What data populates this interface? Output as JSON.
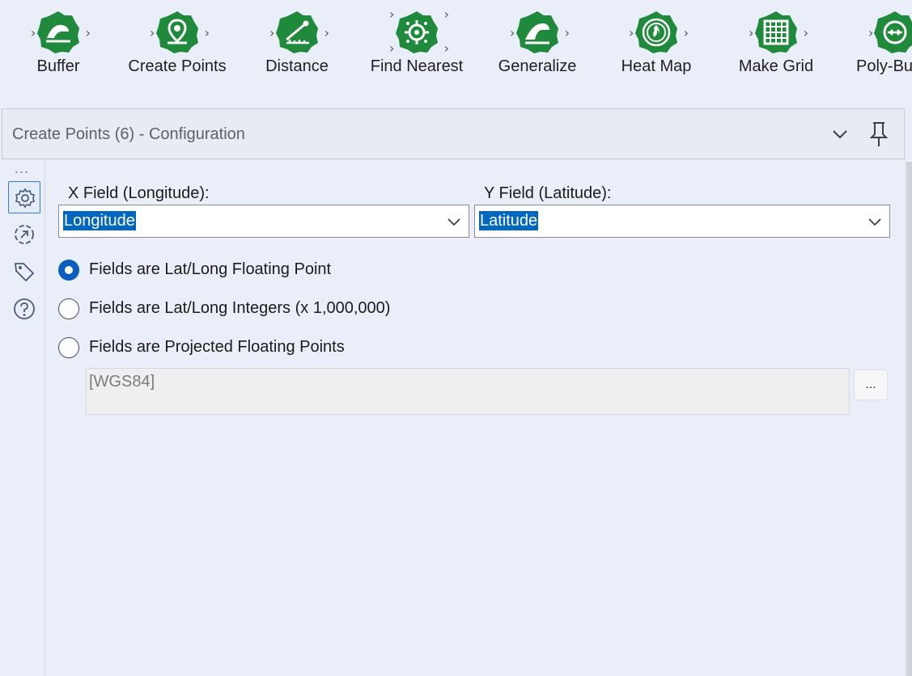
{
  "palette": {
    "tools": [
      {
        "label": "Buffer",
        "icon": "buffer-icon"
      },
      {
        "label": "Create Points",
        "icon": "create-points-icon"
      },
      {
        "label": "Distance",
        "icon": "distance-icon"
      },
      {
        "label": "Find Nearest",
        "icon": "find-nearest-icon"
      },
      {
        "label": "Generalize",
        "icon": "generalize-icon"
      },
      {
        "label": "Heat Map",
        "icon": "heat-map-icon"
      },
      {
        "label": "Make Grid",
        "icon": "make-grid-icon"
      },
      {
        "label": "Poly-Bu",
        "icon": "poly-build-icon"
      }
    ],
    "tool_color": "#1f8a3b"
  },
  "panel": {
    "title": "Create Points (6) - Configuration",
    "rail_dots": "...",
    "rail_icons": [
      "gear-icon",
      "connection-icon",
      "tag-icon",
      "help-icon"
    ]
  },
  "config": {
    "x_field_label": "X Field (Longitude):",
    "x_field_value": "Longitude",
    "y_field_label": "Y Field (Latitude):",
    "y_field_value": "Latitude",
    "options": [
      {
        "label": "Fields are Lat/Long Floating Point",
        "checked": true
      },
      {
        "label": "Fields are Lat/Long Integers (x 1,000,000)",
        "checked": false
      },
      {
        "label": "Fields are Projected Floating Points",
        "checked": false
      }
    ],
    "projection_value": "[WGS84]",
    "browse_label": "..."
  },
  "colors": {
    "accent": "#0a5fbe",
    "selection": "#0067c0",
    "background": "#eaeef8"
  }
}
